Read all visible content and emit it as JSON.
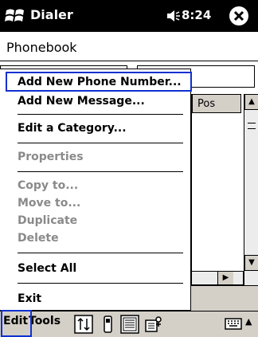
{
  "titlebar": {
    "app_name": "Dialer",
    "time": "8:24"
  },
  "header": {
    "title": "Phonebook"
  },
  "grid": {
    "column_header": "Pos"
  },
  "menu": {
    "items": [
      {
        "label": "Add New Phone Number...",
        "enabled": true
      },
      {
        "label": "Add New Message...",
        "enabled": true
      },
      {
        "label": "Edit a Category...",
        "enabled": true
      },
      {
        "label": "Properties",
        "enabled": false
      },
      {
        "label": "Copy to...",
        "enabled": false
      },
      {
        "label": "Move to...",
        "enabled": false
      },
      {
        "label": "Duplicate",
        "enabled": false
      },
      {
        "label": "Delete",
        "enabled": false
      },
      {
        "label": "Select All",
        "enabled": true
      },
      {
        "label": "Exit",
        "enabled": true
      }
    ]
  },
  "cmdbar": {
    "edit_label": "Edit",
    "tools_label": "Tools"
  },
  "icons": {
    "start": "windows-flag-icon",
    "volume": "speaker-icon",
    "close": "close-icon",
    "sort": "sort-icon",
    "phone": "phone-icon",
    "view": "list-view-icon",
    "contacts": "contacts-icon",
    "keyboard": "keyboard-icon"
  },
  "colors": {
    "highlight": "#1030d0",
    "titlebar": "#000000",
    "commandbar": "#d4d0c8",
    "disabled_text": "#8a8a8a"
  }
}
